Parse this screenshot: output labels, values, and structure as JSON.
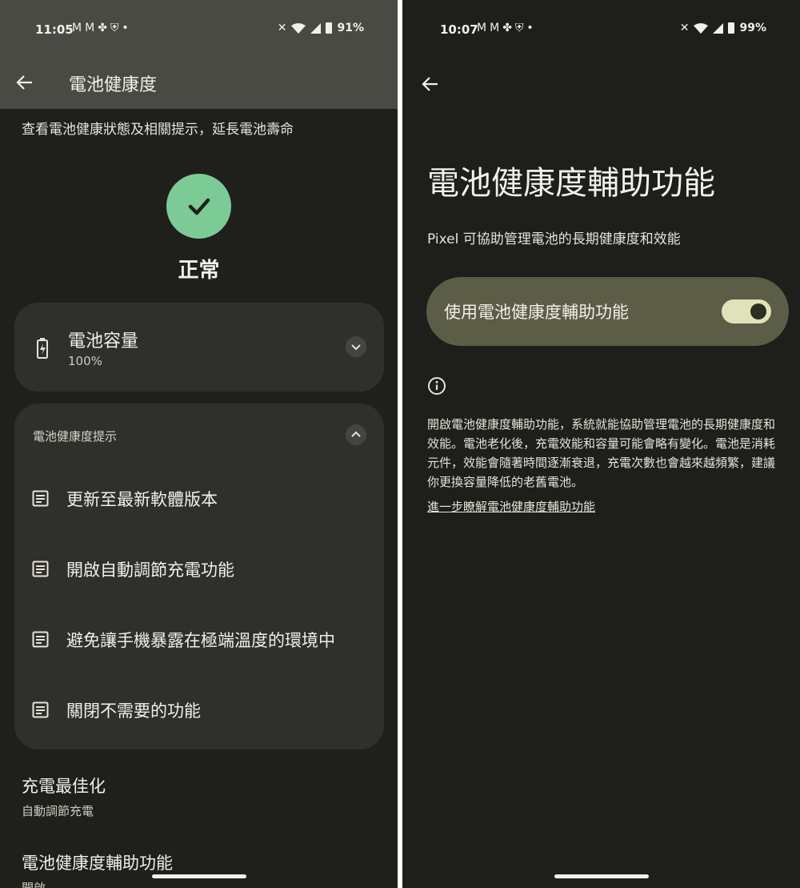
{
  "left_screen": {
    "status": {
      "time": "11:05",
      "battery": "91%"
    },
    "header": {
      "title": "電池健康度"
    },
    "subtitle": "查看電池健康狀態及相關提示，延長電池壽命",
    "status_label": "正常",
    "capacity_card": {
      "title": "電池容量",
      "value": "100%"
    },
    "tips_card": {
      "header": "電池健康度提示",
      "items": [
        {
          "label": "更新至最新軟體版本"
        },
        {
          "label": "開啟自動調節充電功能"
        },
        {
          "label": "避免讓手機暴露在極端溫度的環境中"
        },
        {
          "label": "關閉不需要的功能"
        }
      ]
    },
    "settings": [
      {
        "title": "充電最佳化",
        "subtitle": "自動調節充電"
      },
      {
        "title": "電池健康度輔助功能",
        "subtitle": "開啟"
      }
    ]
  },
  "right_screen": {
    "status": {
      "time": "10:07",
      "battery": "99%"
    },
    "title": "電池健康度輔助功能",
    "description": "Pixel 可協助管理電池的長期健康度和效能",
    "toggle": {
      "label": "使用電池健康度輔助功能",
      "state": "on"
    },
    "body": "開啟電池健康度輔助功能，系統就能協助管理電池的長期健康度和效能。電池老化後，充電效能和容量可能會略有變化。電池是消耗元件，效能會隨著時間逐漸衰退，充電次數也會越來越頻繁，建議你更換容量降低的老舊電池。",
    "link": "進一步瞭解電池健康度輔助功能"
  },
  "colors": {
    "background": "#1f201b",
    "card": "#2f2f2b",
    "appbar": "#4a4a44",
    "ok_green": "#7ccb97",
    "toggle_card": "#5c5d47",
    "switch_track": "#e1e2ba"
  },
  "icons": {
    "back": "arrow-left-icon",
    "status_ok": "checkmark-icon",
    "capacity": "battery-charging-icon",
    "tip": "article-icon",
    "info": "info-circle-icon"
  }
}
